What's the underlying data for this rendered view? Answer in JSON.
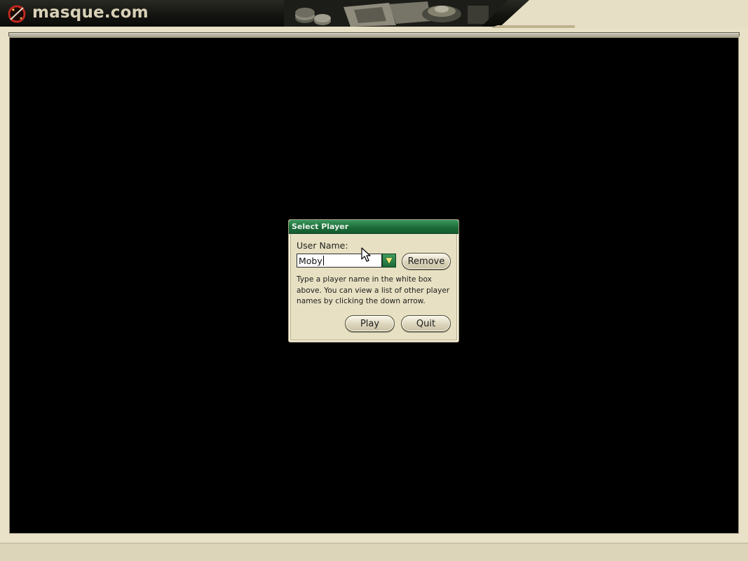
{
  "header": {
    "logo_text": "masque.com"
  },
  "dialog": {
    "title": "Select Player",
    "user_name_label": "User Name:",
    "user_name_value": "Moby",
    "remove_label": "Remove",
    "help_text": "Type a player name in the white box above. You can view a list of other player names by clicking the down arrow.",
    "play_label": "Play",
    "quit_label": "Quit",
    "dropdown_icon": "down-arrow-icon"
  },
  "colors": {
    "title_bar_green": "#1d6d3a",
    "dropdown_arrow": "#f4e87a",
    "frame_beige": "#e9e2c9",
    "game_area": "#000000"
  }
}
